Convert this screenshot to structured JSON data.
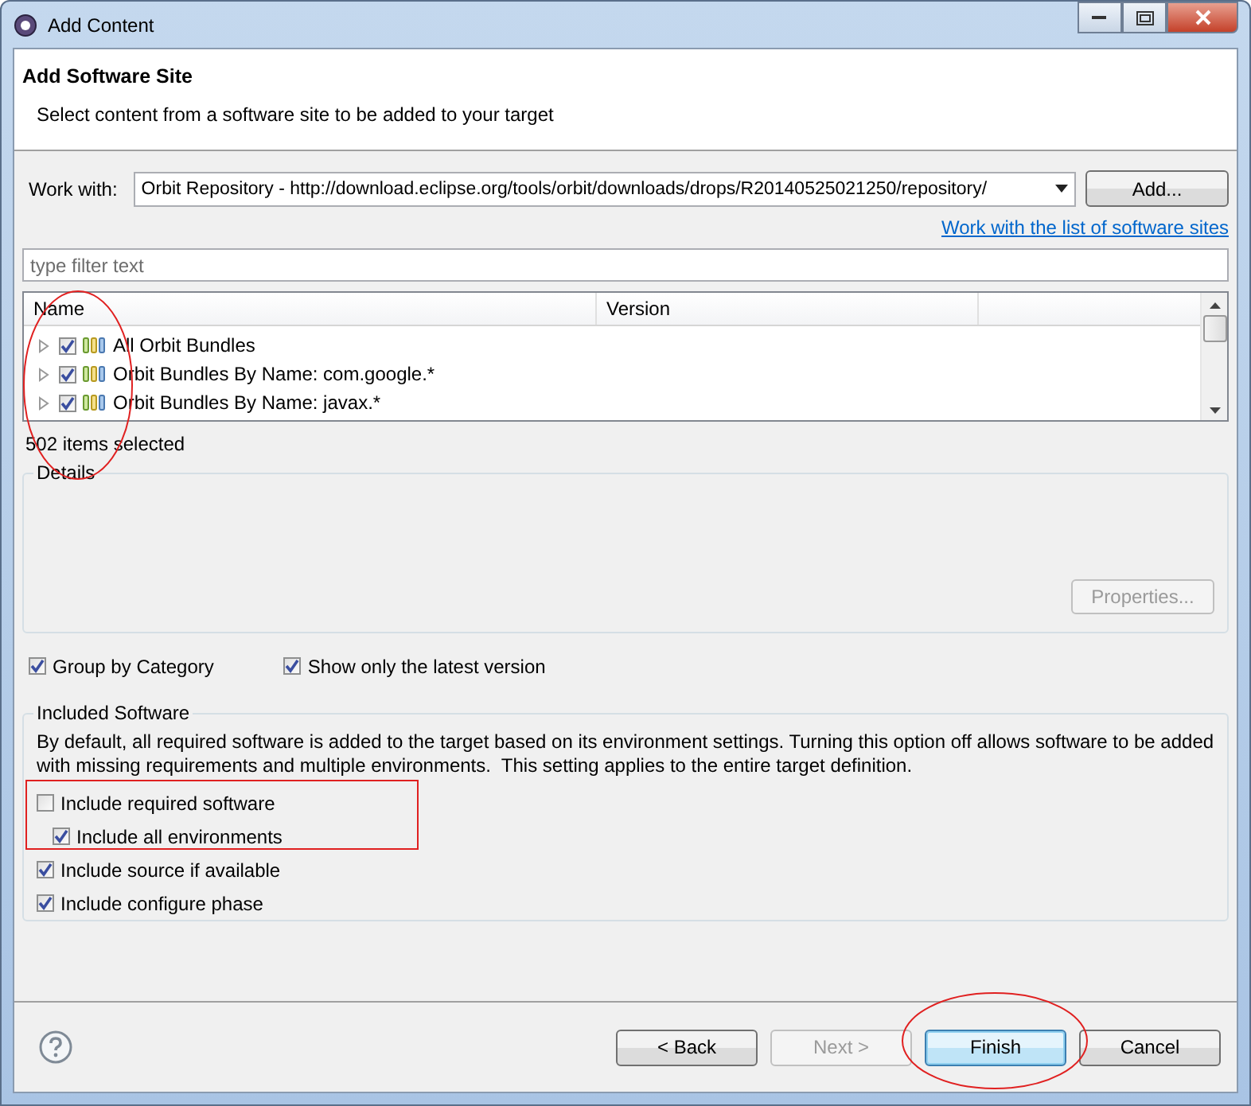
{
  "window": {
    "title": "Add Content"
  },
  "header": {
    "title": "Add Software Site",
    "description": "Select content from a software site to be added to your target"
  },
  "work_with": {
    "label": "Work with:",
    "value": "Orbit Repository - http://download.eclipse.org/tools/orbit/downloads/drops/R20140525021250/repository/",
    "add_button": "Add...",
    "link": "Work with the list of software sites"
  },
  "filter": {
    "placeholder": "type filter text"
  },
  "tree": {
    "columns": [
      "Name",
      "Version"
    ],
    "rows": [
      {
        "label": "All Orbit Bundles",
        "checked": true,
        "expanded": false
      },
      {
        "label": "Orbit Bundles By Name: com.google.*",
        "checked": true,
        "expanded": false
      },
      {
        "label": "Orbit Bundles By Name: javax.*",
        "checked": true,
        "expanded": false
      }
    ]
  },
  "selection_status": "502 items selected",
  "details": {
    "title": "Details",
    "properties_button": {
      "label": "Properties...",
      "disabled": true
    }
  },
  "view_options": [
    {
      "label": "Group by Category",
      "checked": true
    },
    {
      "label": "Show only the latest version",
      "checked": true
    }
  ],
  "included_software": {
    "title": "Included Software",
    "description": "By default, all required software is added to the target based on its environment settings. Turning this option off allows software to be added with missing requirements and multiple environments.  This setting applies to the entire target definition.",
    "options": [
      {
        "label": "Include required software",
        "checked": false,
        "children": [
          {
            "label": "Include all environments",
            "checked": true
          }
        ]
      },
      {
        "label": "Include source if available",
        "checked": true
      },
      {
        "label": "Include configure phase",
        "checked": true
      }
    ]
  },
  "buttons": [
    {
      "label": "< Back",
      "disabled": false,
      "default": false
    },
    {
      "label": "Next >",
      "disabled": true,
      "default": false
    },
    {
      "label": "Finish",
      "disabled": false,
      "default": true
    },
    {
      "label": "Cancel",
      "disabled": false,
      "default": false
    }
  ]
}
